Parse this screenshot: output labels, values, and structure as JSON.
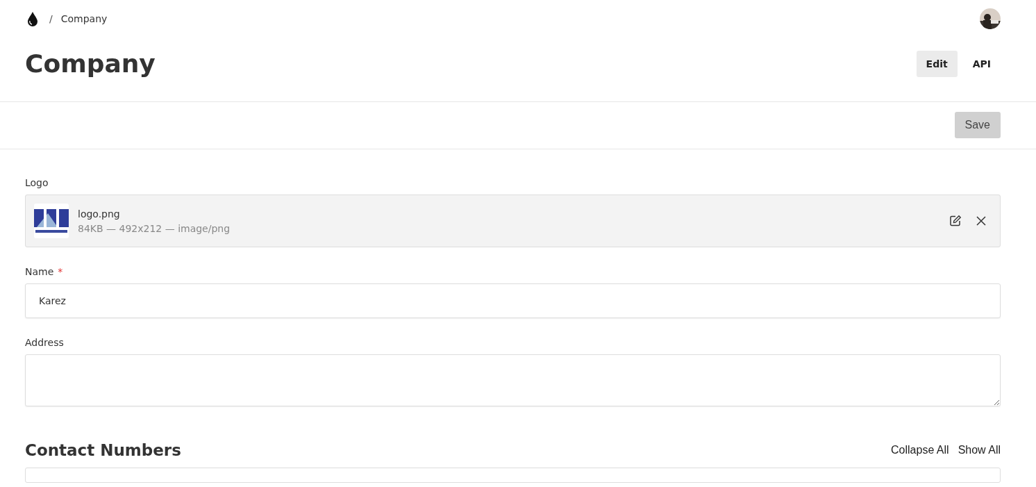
{
  "breadcrumb": {
    "separator": "/",
    "current": "Company"
  },
  "title": "Company",
  "tabs": [
    {
      "label": "Edit",
      "selected": true
    },
    {
      "label": "API",
      "selected": false
    }
  ],
  "save_button": {
    "label": "Save",
    "disabled": true
  },
  "fields": [
    {
      "kind": "file",
      "label": "Logo",
      "file_name": "logo.png",
      "file_info": "84KB — 492x212 — image/png"
    },
    {
      "kind": "input",
      "label": "Name",
      "required_mark": "*",
      "value": "Karez"
    },
    {
      "kind": "textarea",
      "label": "Address"
    }
  ],
  "section": {
    "title": "Contact Numbers",
    "actions": [
      "Collapse All",
      "Show All"
    ]
  }
}
